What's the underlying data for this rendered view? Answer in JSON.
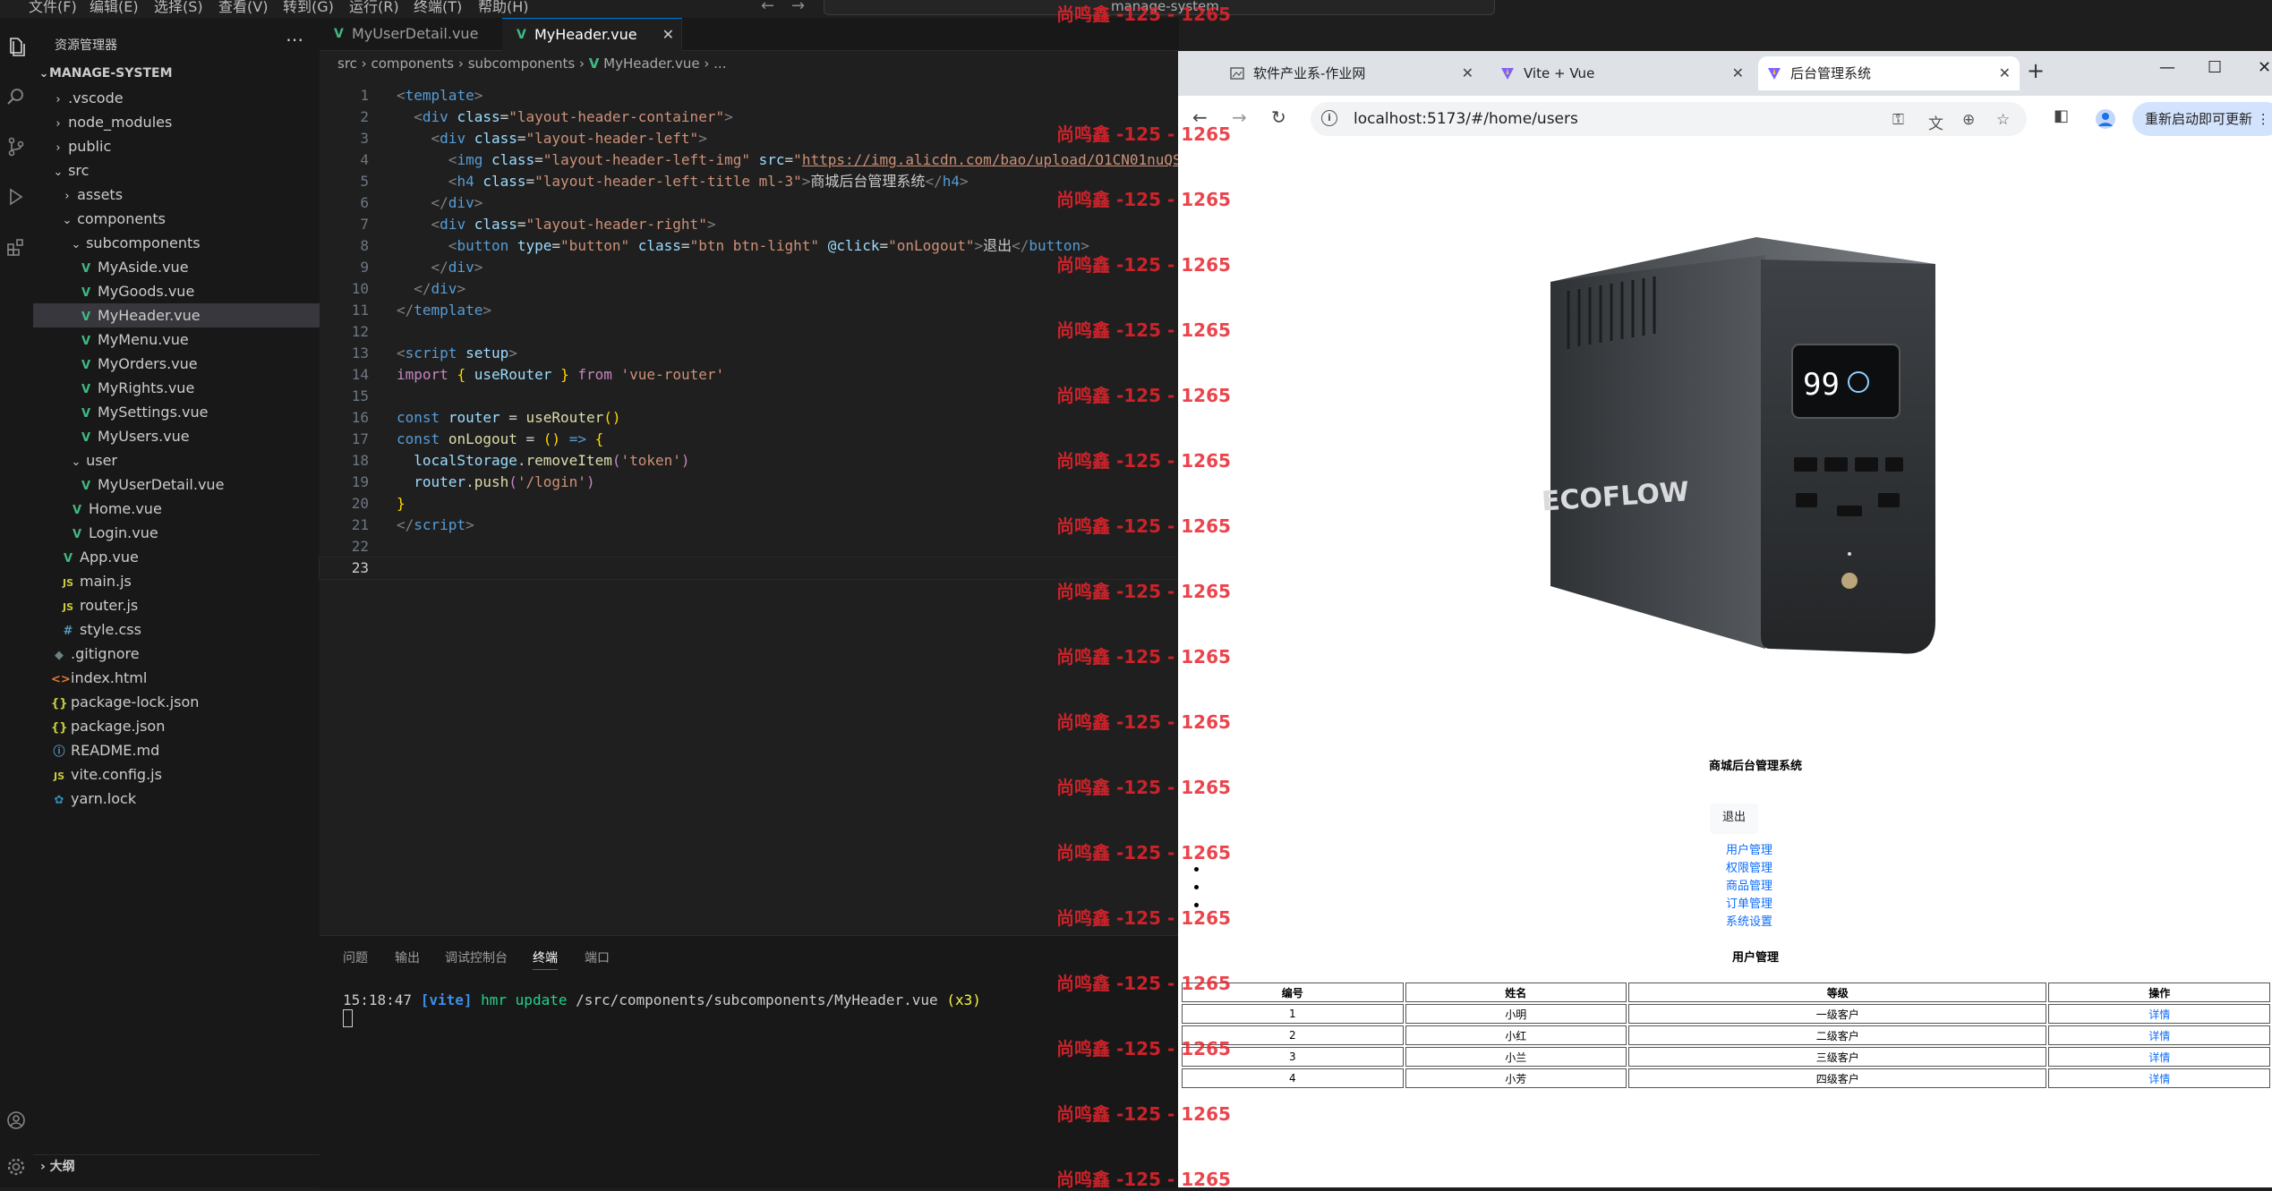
{
  "menubar": {
    "items": [
      "文件(F)",
      "编辑(E)",
      "选择(S)",
      "查看(V)",
      "转到(G)",
      "运行(R)",
      "终端(T)",
      "帮助(H)"
    ],
    "command_center": "manage-system"
  },
  "explorer": {
    "title": "资源管理器",
    "root": "MANAGE-SYSTEM",
    "items": [
      {
        "label": ".vscode"
      },
      {
        "label": "node_modules"
      },
      {
        "label": "public"
      },
      {
        "label": "src"
      },
      {
        "label": "assets"
      },
      {
        "label": "components"
      },
      {
        "label": "subcomponents"
      },
      {
        "label": "MyAside.vue"
      },
      {
        "label": "MyGoods.vue"
      },
      {
        "label": "MyHeader.vue"
      },
      {
        "label": "MyMenu.vue"
      },
      {
        "label": "MyOrders.vue"
      },
      {
        "label": "MyRights.vue"
      },
      {
        "label": "MySettings.vue"
      },
      {
        "label": "MyUsers.vue"
      },
      {
        "label": "user"
      },
      {
        "label": "MyUserDetail.vue"
      },
      {
        "label": "Home.vue"
      },
      {
        "label": "Login.vue"
      },
      {
        "label": "App.vue"
      },
      {
        "label": "main.js"
      },
      {
        "label": "router.js"
      },
      {
        "label": "style.css"
      },
      {
        "label": ".gitignore"
      },
      {
        "label": "index.html"
      },
      {
        "label": "package-lock.json"
      },
      {
        "label": "package.json"
      },
      {
        "label": "README.md"
      },
      {
        "label": "vite.config.js"
      },
      {
        "label": "yarn.lock"
      }
    ],
    "outline": "大纲"
  },
  "editor": {
    "tabs": [
      "MyUserDetail.vue",
      "MyHeader.vue"
    ],
    "breadcrumb": [
      "src",
      "components",
      "subcomponents",
      "MyHeader.vue",
      "..."
    ],
    "line_numbers": [
      "1",
      "2",
      "3",
      "4",
      "5",
      "6",
      "7",
      "8",
      "9",
      "10",
      "11",
      "12",
      "13",
      "14",
      "15",
      "16",
      "17",
      "18",
      "19",
      "20",
      "21",
      "22",
      "23"
    ],
    "code_strings": {
      "img_src": "https://img.alicdn.com/bao/upload/O1CN01nuQS",
      "title_text": "商城后台管理系统",
      "logout_text": "退出",
      "import_from": "'vue-router'",
      "token_key": "'token'",
      "login_path": "'/login'"
    }
  },
  "panel": {
    "tabs": [
      "问题",
      "输出",
      "调试控制台",
      "终端",
      "端口"
    ],
    "terminal_time": "15:18:47",
    "terminal_tag": "[vite]",
    "terminal_msg": "hmr update",
    "terminal_path": "/src/components/subcomponents/MyHeader.vue",
    "terminal_count": "(x3)"
  },
  "browser": {
    "tabs": [
      "软件产业系-作业网",
      "Vite + Vue",
      "后台管理系统"
    ],
    "url": "localhost:5173/#/home/users",
    "update_button": "重新启动即可更新",
    "page": {
      "site_title": "商城后台管理系统",
      "logout": "退出",
      "menu": [
        "用户管理",
        "权限管理",
        "商品管理",
        "订单管理",
        "系统设置"
      ],
      "section_title": "用户管理",
      "product_brand": "ECOFLOW",
      "product_display": "99",
      "table": {
        "headers": [
          "编号",
          "姓名",
          "等级",
          "操作"
        ],
        "rows": [
          [
            "1",
            "小明",
            "一级客户",
            "详情"
          ],
          [
            "2",
            "小红",
            "二级客户",
            "详情"
          ],
          [
            "3",
            "小兰",
            "三级客户",
            "详情"
          ],
          [
            "4",
            "小芳",
            "四级客户",
            "详情"
          ]
        ]
      }
    }
  },
  "watermark": "尚鸣鑫 -125 - 1265"
}
